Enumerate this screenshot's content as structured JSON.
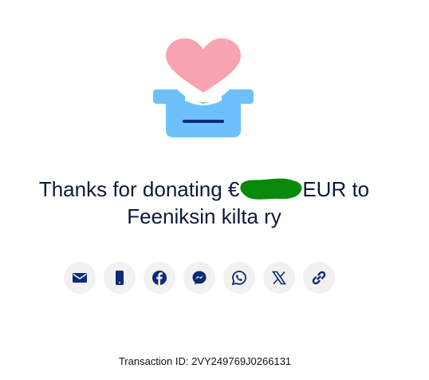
{
  "headline": {
    "prefix": "Thanks for donating €",
    "suffix": "EUR to",
    "recipient": "Feeniksin kilta ry"
  },
  "share": {
    "buttons": [
      {
        "icon": "email-icon"
      },
      {
        "icon": "phone-icon"
      },
      {
        "icon": "facebook-icon"
      },
      {
        "icon": "messenger-icon"
      },
      {
        "icon": "whatsapp-icon"
      },
      {
        "icon": "x-icon"
      },
      {
        "icon": "link-icon"
      }
    ]
  },
  "transaction": {
    "label": "Transaction ID: 2VY249769J0266131"
  },
  "colors": {
    "icon": "#0b2a7a",
    "button_bg": "#f3f1ef",
    "heart": "#f7a3b0",
    "box": "#6cc1fb",
    "redaction": "#0a8a0a"
  }
}
